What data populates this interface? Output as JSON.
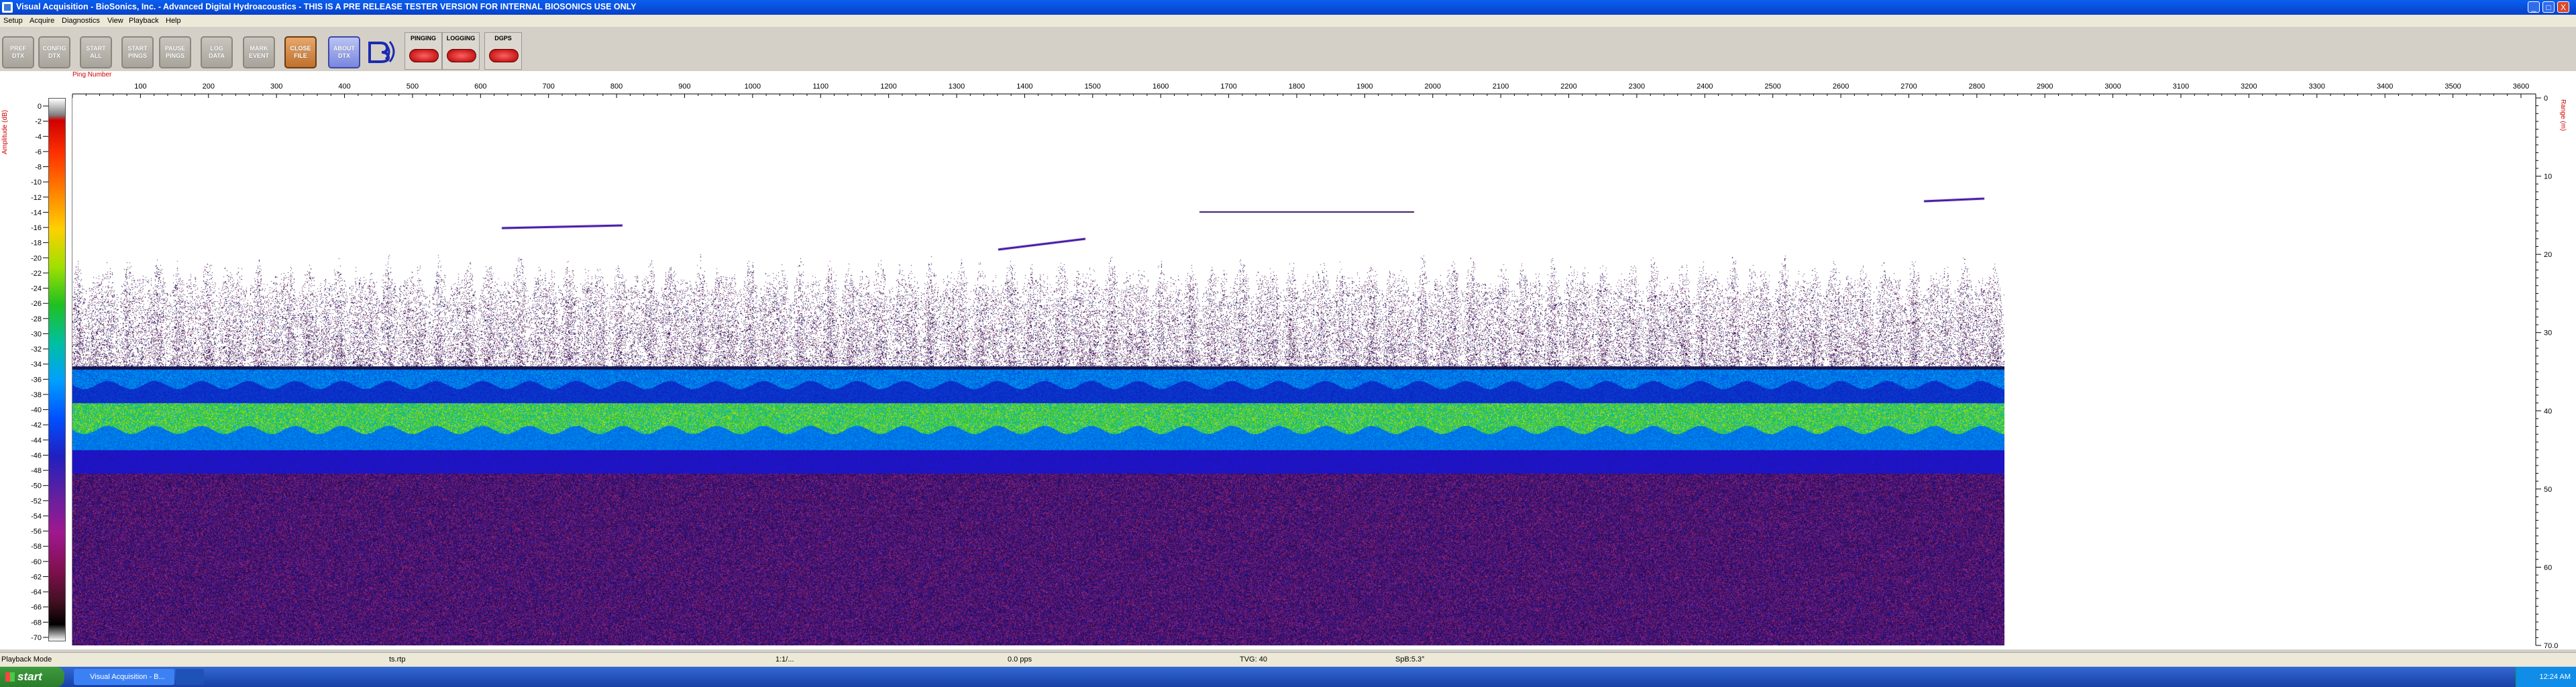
{
  "window": {
    "title": "Visual Acquisition  -  BioSonics, Inc.  -  Advanced Digital Hydroacoustics  -  THIS IS A PRE RELEASE TESTER VERSION FOR INTERNAL BIOSONICS USE ONLY",
    "minimize": "_",
    "maximize": "□",
    "close": "X"
  },
  "menu": [
    "Setup",
    "Acquire",
    "Diagnostics",
    "View",
    "Playback",
    "Help"
  ],
  "toolbar": {
    "buttons": [
      {
        "label": "PREF\nDTX",
        "style": "gray"
      },
      {
        "label": "CONFIG\nDTX",
        "style": "gray"
      },
      {
        "label": "START\nALL",
        "style": "gray"
      },
      {
        "label": "START\nPINGS",
        "style": "gray"
      },
      {
        "label": "PAUSE\nPINGS",
        "style": "gray"
      },
      {
        "label": "LOG\nDATA",
        "style": "gray"
      },
      {
        "label": "MARK\nEVENT",
        "style": "gray"
      },
      {
        "label": "CLOSE\nFILE",
        "style": "orange"
      },
      {
        "label": "ABOUT\nDTX",
        "style": "blue"
      }
    ],
    "indicators": [
      {
        "label": "PINGING",
        "state": "OFF"
      },
      {
        "label": "LOGGING",
        "state": "OFF"
      },
      {
        "label": "DGPS",
        "state": "OFF"
      }
    ]
  },
  "echogram": {
    "x_axis_title": "Ping Number",
    "x_ticks": [
      100,
      200,
      300,
      400,
      500,
      600,
      700,
      800,
      900,
      1000,
      1100,
      1200,
      1300,
      1400,
      1500,
      1600,
      1700,
      1800,
      1900,
      2000,
      2100,
      2200,
      2300,
      2400,
      2500,
      2600,
      2700,
      2800,
      2900,
      3000,
      3100,
      3200,
      3300,
      3400,
      3500,
      3600
    ],
    "left_axis_title": "Amplitude (dB)",
    "amplitude_ticks": [
      0,
      -2,
      -4,
      -6,
      -8,
      -10,
      -12,
      -14,
      -16,
      -18,
      -20,
      -22,
      -24,
      -26,
      -28,
      -30,
      -32,
      -34,
      -36,
      -38,
      -40,
      -42,
      -44,
      -46,
      -48,
      -50,
      -52,
      -54,
      -56,
      -58,
      -60,
      -62,
      -64,
      -66,
      -68,
      -70
    ],
    "right_axis_title": "Range (m)",
    "range_ticks": [
      "0",
      "10",
      "20",
      "30",
      "40",
      "50",
      "60",
      "70.0"
    ],
    "colors": {
      "axis_title": "#d00000"
    }
  },
  "status": {
    "mode": "Playback Mode",
    "file": "ts.rtp",
    "ping": "1:1/...",
    "rate": "0.0 pps",
    "tvg": "TVG: 40",
    "spb": "SpB:5.3°"
  },
  "taskbar": {
    "start": "start",
    "tasks": [
      {
        "label": "Visual Acquisition  -  B..."
      },
      {
        "label": ""
      }
    ],
    "clock": "12:24 AM"
  }
}
